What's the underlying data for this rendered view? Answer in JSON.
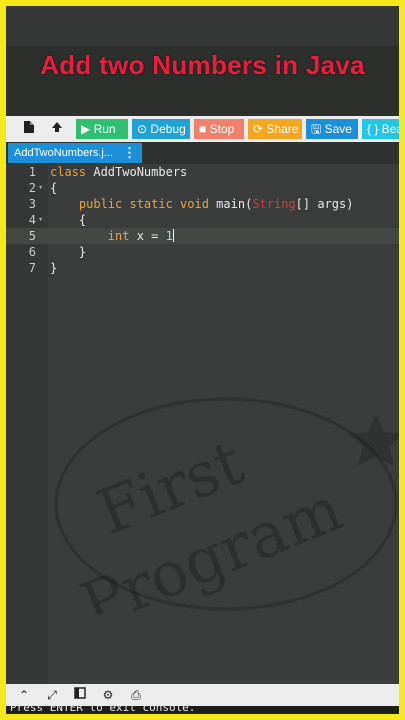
{
  "video_title": "Add two Numbers in Java",
  "toolbar": {
    "new_file_icon": "file-icon",
    "upload_icon": "upload-icon",
    "run_label": "Run",
    "debug_label": "Debug",
    "stop_label": "Stop",
    "share_label": "Share",
    "save_label": "Save",
    "beautify_label": "{ } Bea",
    "colors": {
      "run": "#2fbf71",
      "debug": "#1fa3d6",
      "stop": "#f0806c",
      "share": "#f4a623",
      "save": "#1d8fd8",
      "beautify": "#22c6e8"
    }
  },
  "tab": {
    "filename": "AddTwoNumbers.j...",
    "menu_icon": "vertical-dots-icon"
  },
  "editor": {
    "lines": [
      {
        "number": "1",
        "fold": "",
        "text": "class AddTwoNumbers"
      },
      {
        "number": "2",
        "fold": "▾",
        "text": "{"
      },
      {
        "number": "3",
        "fold": "",
        "kw": "public static void",
        "fn": " main(",
        "type": "String",
        "rest": "[] args)"
      },
      {
        "number": "4",
        "fold": "▾",
        "text": "{"
      },
      {
        "number": "5",
        "fold": "",
        "kw": "int",
        "rest": " x = ",
        "num": "1"
      },
      {
        "number": "6",
        "fold": "",
        "text": "}"
      },
      {
        "number": "7",
        "fold": "",
        "text": "}"
      }
    ]
  },
  "watermark": {
    "line1": "First",
    "line2": "Program"
  },
  "bottom_bar": {
    "icons": [
      "chevron-up-icon",
      "expand-icon",
      "terminal-icon",
      "gear-icon",
      "input-icon"
    ]
  },
  "console": {
    "text": "Press ENTER to exit console."
  }
}
